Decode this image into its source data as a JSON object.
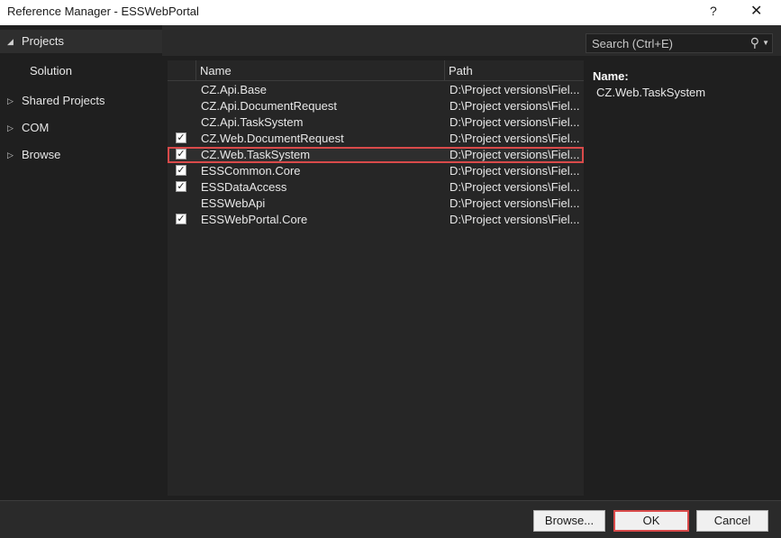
{
  "window": {
    "title": "Reference Manager - ESSWebPortal",
    "help_label": "?",
    "close_label": "✕"
  },
  "sidebar": {
    "items": [
      {
        "label": "Projects",
        "expanded": true,
        "selected": true
      },
      {
        "label": "Shared Projects",
        "expanded": false
      },
      {
        "label": "COM",
        "expanded": false
      },
      {
        "label": "Browse",
        "expanded": false
      }
    ],
    "sub_items": [
      {
        "label": "Solution"
      }
    ]
  },
  "search": {
    "placeholder": "Search (Ctrl+E)",
    "icon": "search-icon"
  },
  "table": {
    "columns": [
      "Name",
      "Path"
    ],
    "rows": [
      {
        "checked": false,
        "name": "CZ.Api.Base",
        "path": "D:\\Project versions\\Fiel..."
      },
      {
        "checked": false,
        "name": "CZ.Api.DocumentRequest",
        "path": "D:\\Project versions\\Fiel..."
      },
      {
        "checked": false,
        "name": "CZ.Api.TaskSystem",
        "path": "D:\\Project versions\\Fiel..."
      },
      {
        "checked": true,
        "name": "CZ.Web.DocumentRequest",
        "path": "D:\\Project versions\\Fiel..."
      },
      {
        "checked": true,
        "name": "CZ.Web.TaskSystem",
        "path": "D:\\Project versions\\Fiel...",
        "highlighted": true
      },
      {
        "checked": true,
        "name": "ESSCommon.Core",
        "path": "D:\\Project versions\\Fiel..."
      },
      {
        "checked": true,
        "name": "ESSDataAccess",
        "path": "D:\\Project versions\\Fiel..."
      },
      {
        "checked": false,
        "name": "ESSWebApi",
        "path": "D:\\Project versions\\Fiel..."
      },
      {
        "checked": true,
        "name": "ESSWebPortal.Core",
        "path": "D:\\Project versions\\Fiel..."
      }
    ]
  },
  "details": {
    "name_label": "Name:",
    "name_value": "CZ.Web.TaskSystem"
  },
  "footer": {
    "browse_label": "Browse...",
    "ok_label": "OK",
    "cancel_label": "Cancel"
  },
  "colors": {
    "background": "#1f1f1f",
    "highlight_border": "#d94a4a",
    "button_face": "#f0f0f0"
  }
}
